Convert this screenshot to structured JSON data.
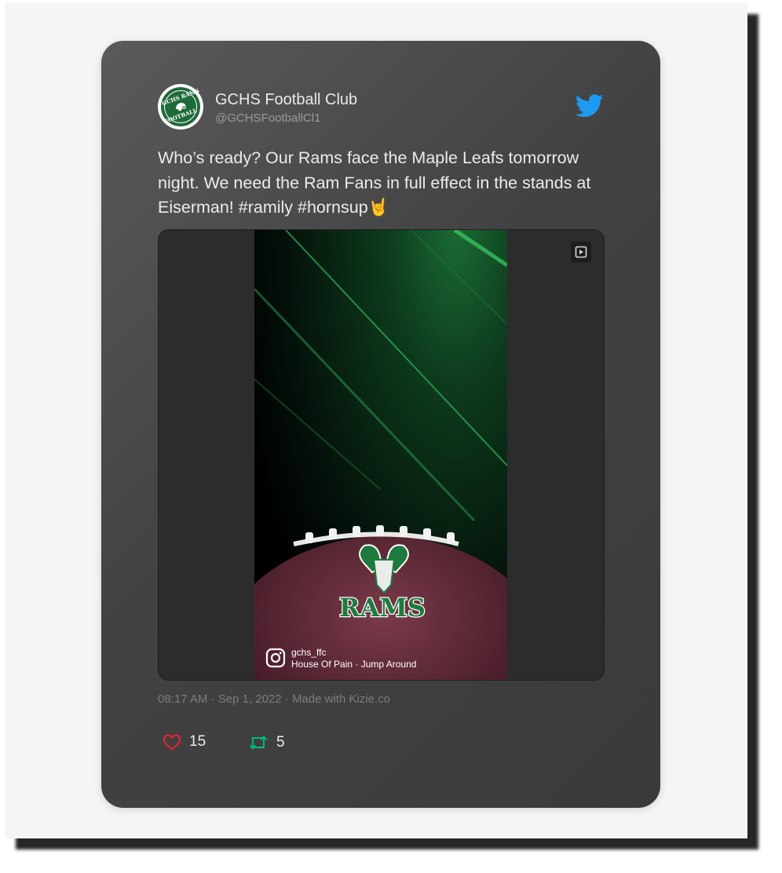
{
  "tweet": {
    "user_name": "GCHS Football Club",
    "user_handle": "@GCHSFootballCl1",
    "avatar_text_top": "GCHS RAMS",
    "avatar_text_bottom": "FOOTBALL",
    "text": "Who’s ready? Our Rams face the Maple Leafs tomorrow night. We need the Ram Fans in full effect in the stands at Eiserman! #ramily #hornsup🤘",
    "media": {
      "logo_text": "RAMS",
      "ig_username": "gchs_ffc",
      "ig_song": "House Of Pain · Jump Around"
    },
    "timestamp": "08:17 AM · Sep 1, 2022 · Made with Kizie.co",
    "likes": "15",
    "retweets": "5"
  },
  "colors": {
    "twitter_blue": "#1d9bf0",
    "like_red": "#f4212e",
    "retweet_green": "#00ba7c",
    "team_green": "#1f6a3a"
  },
  "icons": [
    "twitter-bird-icon",
    "heart-icon",
    "retweet-icon",
    "play-icon",
    "instagram-icon"
  ]
}
